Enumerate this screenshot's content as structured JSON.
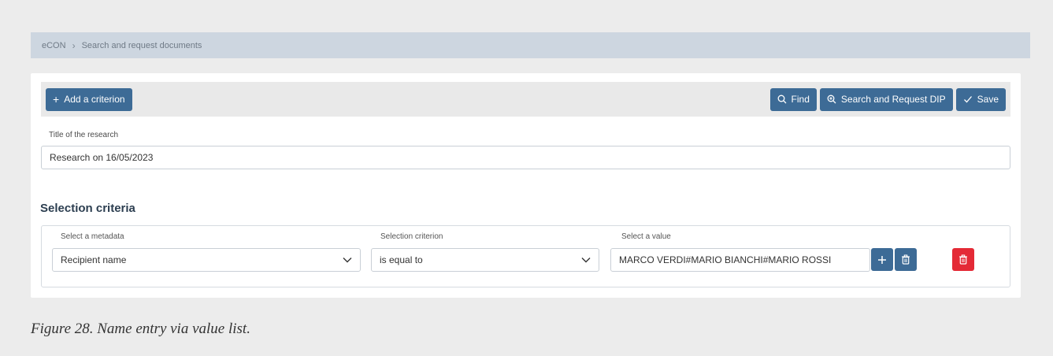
{
  "breadcrumb": {
    "root": "eCON",
    "separator": "›",
    "current": "Search and request documents"
  },
  "toolbar": {
    "add_criterion_label": "Add a criterion",
    "find_label": "Find",
    "search_request_label": "Search and Request DIP",
    "save_label": "Save"
  },
  "research": {
    "title_label": "Title of the research",
    "title_value": "Research on 16/05/2023"
  },
  "selection": {
    "heading": "Selection criteria",
    "metadata_label": "Select a metadata",
    "metadata_value": "Recipient name",
    "criterion_label": "Selection criterion",
    "criterion_value": "is equal to",
    "value_label": "Select a value",
    "value_value": "MARCO VERDI#MARIO BIANCHI#MARIO ROSSI"
  },
  "caption": "Figure 28. Name entry via value list.",
  "colors": {
    "primary": "#3d6b96",
    "danger": "#e42a36",
    "breadcrumb_bg": "#cdd6e0"
  }
}
